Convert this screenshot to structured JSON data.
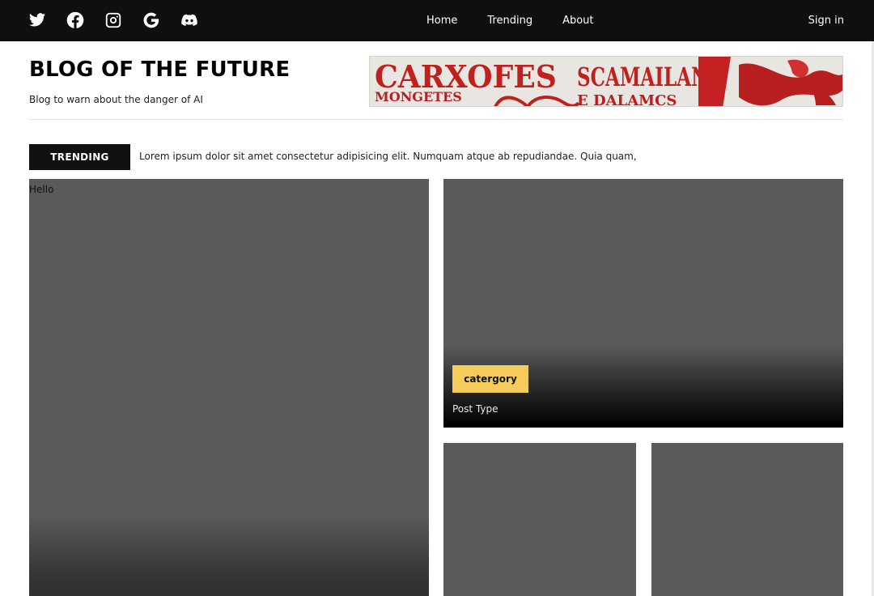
{
  "topbar": {
    "social_icons": [
      "twitter-icon",
      "facebook-icon",
      "instagram-icon",
      "google-icon",
      "discord-icon"
    ],
    "nav": [
      "Home",
      "Trending",
      "About"
    ],
    "signin": "Sign in"
  },
  "header": {
    "title": "BLOG OF THE FUTURE",
    "tagline": "Blog to warn about the danger of AI",
    "banner_lines": [
      "CARXOFES",
      "SCAMAILANS",
      "MONGETES",
      "E DALAMCS"
    ]
  },
  "trending": {
    "label": "TRENDING",
    "text": "Lorem ipsum dolor sit amet consectetur adipisicing elit. Numquam atque ab repudiandae. Quia quam,"
  },
  "cards": {
    "main_text": "Hello",
    "feature_category": "catergory",
    "feature_type": "Post Type"
  },
  "colors": {
    "topbar": "#0f0f0f",
    "card": "#5a5a5a",
    "category_badge": "#f5cc5c",
    "banner_red": "#c0201e"
  }
}
